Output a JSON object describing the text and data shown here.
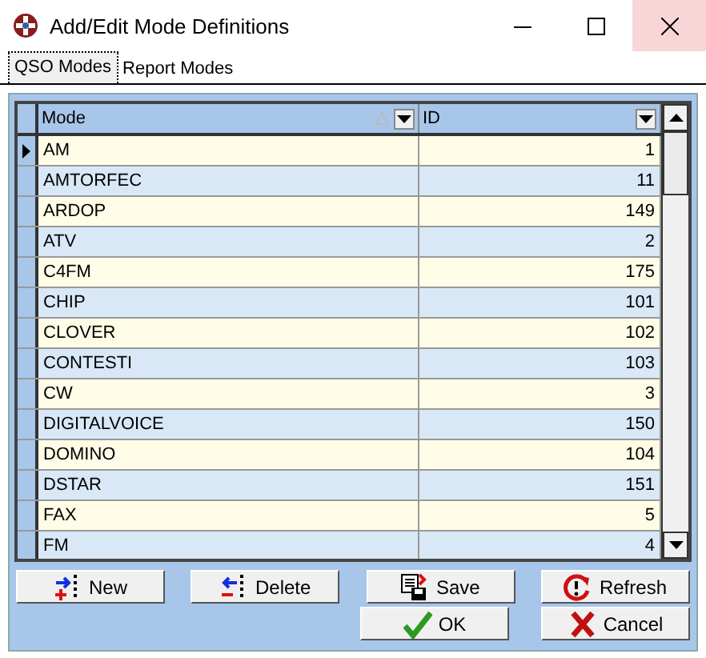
{
  "window": {
    "title": "Add/Edit Mode Definitions"
  },
  "tabs": [
    {
      "label": "QSO Modes",
      "selected": true
    },
    {
      "label": "Report Modes",
      "selected": false
    }
  ],
  "table": {
    "columns": [
      "Mode",
      "ID"
    ],
    "rows": [
      {
        "mode": "AM",
        "id": "1",
        "selected": true
      },
      {
        "mode": "AMTORFEC",
        "id": "11",
        "selected": false
      },
      {
        "mode": "ARDOP",
        "id": "149",
        "selected": false
      },
      {
        "mode": "ATV",
        "id": "2",
        "selected": false
      },
      {
        "mode": "C4FM",
        "id": "175",
        "selected": false
      },
      {
        "mode": "CHIP",
        "id": "101",
        "selected": false
      },
      {
        "mode": "CLOVER",
        "id": "102",
        "selected": false
      },
      {
        "mode": "CONTESTI",
        "id": "103",
        "selected": false
      },
      {
        "mode": "CW",
        "id": "3",
        "selected": false
      },
      {
        "mode": "DIGITALVOICE",
        "id": "150",
        "selected": false
      },
      {
        "mode": "DOMINO",
        "id": "104",
        "selected": false
      },
      {
        "mode": "DSTAR",
        "id": "151",
        "selected": false
      },
      {
        "mode": "FAX",
        "id": "5",
        "selected": false
      },
      {
        "mode": "FM",
        "id": "4",
        "selected": false
      }
    ]
  },
  "buttons": [
    {
      "label": "New",
      "kind": "new"
    },
    {
      "label": "Delete",
      "kind": "delete"
    },
    {
      "label": "Save",
      "kind": "save"
    },
    {
      "label": "Refresh",
      "kind": "refresh"
    },
    {
      "label": "OK",
      "kind": "ok"
    },
    {
      "label": "Cancel",
      "kind": "cancel"
    }
  ]
}
